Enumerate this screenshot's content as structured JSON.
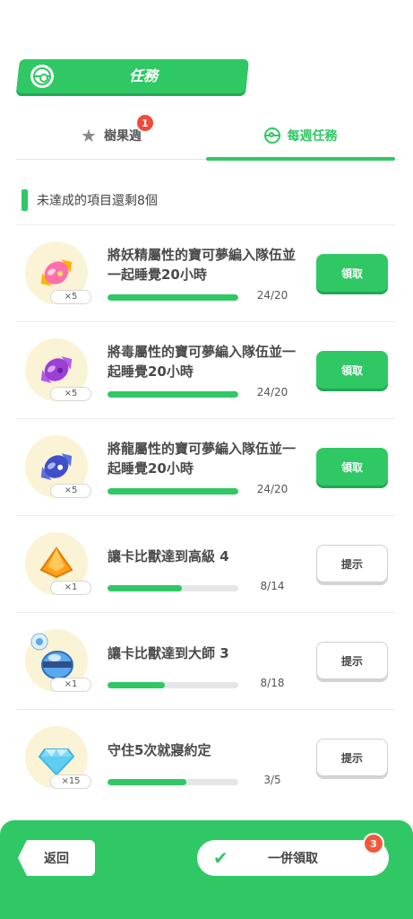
{
  "header": {
    "title": "任務",
    "icon": "pokeball-icon"
  },
  "tabs": [
    {
      "label": "樹果週",
      "icon": "star-icon",
      "badge": "1",
      "active": false
    },
    {
      "label": "每週任務",
      "icon": "pokeball-icon",
      "active": true
    }
  ],
  "remaining_text": "未達成的項目還剩8個",
  "colors": {
    "accent": "#2fc864",
    "badge": "#ef4a3b",
    "icon_bg": "#fbf3d5"
  },
  "missions": [
    {
      "title": "將妖精屬性的寶可夢編入隊伍並一起睡覺20小時",
      "reward_icon": "fairy-candy-icon",
      "qty": "×5",
      "progress_text": "24/20",
      "progress_pct": 100,
      "button": "領取",
      "button_type": "claim"
    },
    {
      "title": "將毒屬性的寶可夢編入隊伍並一起睡覺20小時",
      "reward_icon": "poison-candy-icon",
      "qty": "×5",
      "progress_text": "24/20",
      "progress_pct": 100,
      "button": "領取",
      "button_type": "claim"
    },
    {
      "title": "將龍屬性的寶可夢編入隊伍並一起睡覺20小時",
      "reward_icon": "dragon-candy-icon",
      "qty": "×5",
      "progress_text": "24/20",
      "progress_pct": 100,
      "button": "領取",
      "button_type": "claim"
    },
    {
      "title": "讓卡比獸達到高級 4",
      "reward_icon": "biscuit-icon",
      "qty": "×1",
      "progress_text": "8/14",
      "progress_pct": 57,
      "button": "提示",
      "button_type": "hint"
    },
    {
      "title": "讓卡比獸達到大師 3",
      "reward_icon": "incense-pot-icon",
      "qty": "×1",
      "progress_text": "8/18",
      "progress_pct": 44,
      "button": "提示",
      "button_type": "hint"
    },
    {
      "title": "守住5次就寢約定",
      "reward_icon": "diamond-icon",
      "qty": "×15",
      "progress_text": "3/5",
      "progress_pct": 60,
      "button": "提示",
      "button_type": "hint"
    }
  ],
  "footer": {
    "back_label": "返回",
    "claim_all_label": "一併領取",
    "claim_all_badge": "3"
  }
}
